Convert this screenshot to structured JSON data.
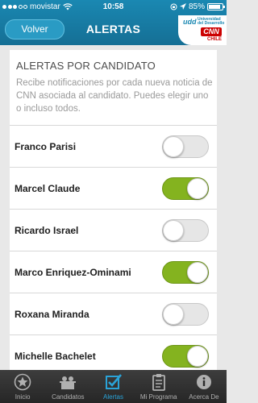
{
  "status_bar": {
    "carrier": "movistar",
    "time": "10:58",
    "battery": "85%",
    "battery_level": 0.85,
    "signal_bars": 3
  },
  "header": {
    "back_label": "Volver",
    "title": "ALERTAS",
    "logo_lines": [
      "Universidad",
      "del Desarrollo"
    ],
    "logo_udd": "udd",
    "logo_cnn": "CNN",
    "logo_chile": "CHILE"
  },
  "section": {
    "title": "ALERTAS POR CANDIDATO",
    "description": "Recibe notificaciones por cada nueva noticia de CNN asociada al candidato. Puedes elegir uno o incluso todos."
  },
  "candidates": [
    {
      "name": "Franco Parisi",
      "enabled": false
    },
    {
      "name": "Marcel Claude",
      "enabled": true
    },
    {
      "name": "Ricardo Israel",
      "enabled": false
    },
    {
      "name": "Marco Enriquez-Ominami",
      "enabled": true
    },
    {
      "name": "Roxana Miranda",
      "enabled": false
    },
    {
      "name": "Michelle Bachelet",
      "enabled": true
    }
  ],
  "tabs": [
    {
      "label": "Inicio",
      "icon": "star-icon",
      "active": false
    },
    {
      "label": "Candidatos",
      "icon": "candidates-icon",
      "active": false
    },
    {
      "label": "Alertas",
      "icon": "checkbox-icon",
      "active": true
    },
    {
      "label": "Mi Programa",
      "icon": "clipboard-icon",
      "active": false
    },
    {
      "label": "Acerca De",
      "icon": "info-icon",
      "active": false
    }
  ],
  "colors": {
    "header": "#1a88b2",
    "toggle_on": "#84b31f",
    "tab_active": "#2aa3d8"
  }
}
